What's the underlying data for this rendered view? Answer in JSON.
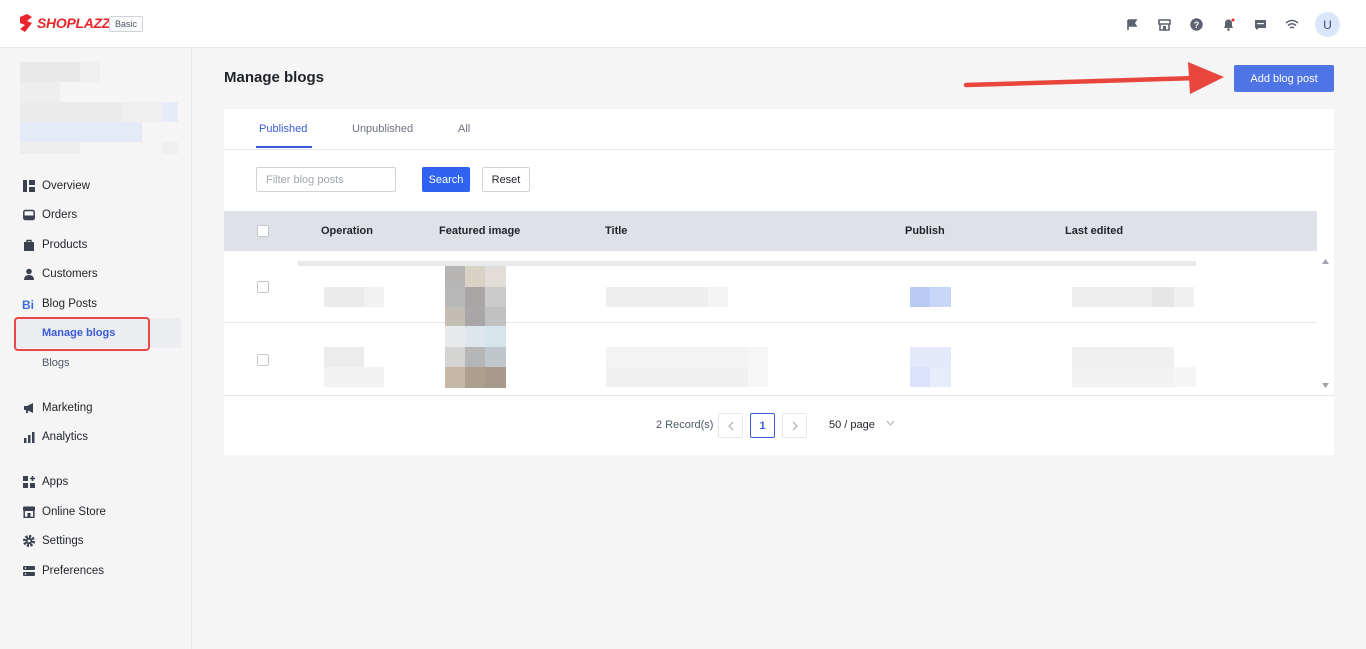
{
  "brand": {
    "name": "SHOPLAZZA",
    "plan": "Basic",
    "color": "#e8262b"
  },
  "topbar": {
    "icons": [
      "flag-icon",
      "store-icon",
      "help-icon",
      "bell-icon",
      "chat-icon",
      "wifi-icon"
    ],
    "avatar_initial": "U"
  },
  "sidebar": {
    "items": [
      {
        "label": "Overview",
        "icon": "overview-icon"
      },
      {
        "label": "Orders",
        "icon": "orders-icon"
      },
      {
        "label": "Products",
        "icon": "products-icon"
      },
      {
        "label": "Customers",
        "icon": "customers-icon"
      },
      {
        "label": "Blog Posts",
        "icon": "blog-icon"
      },
      {
        "label": "Marketing",
        "icon": "megaphone-icon"
      },
      {
        "label": "Analytics",
        "icon": "analytics-icon"
      },
      {
        "label": "Apps",
        "icon": "apps-icon"
      },
      {
        "label": "Online Store",
        "icon": "store-icon"
      },
      {
        "label": "Settings",
        "icon": "gear-icon"
      },
      {
        "label": "Preferences",
        "icon": "preferences-icon"
      }
    ],
    "blog_sub": [
      {
        "label": "Manage blogs",
        "active": true
      },
      {
        "label": "Blogs",
        "active": false
      }
    ]
  },
  "main": {
    "title": "Manage blogs",
    "add_button": "Add blog post",
    "tabs": [
      {
        "label": "Published",
        "active": true
      },
      {
        "label": "Unpublished",
        "active": false
      },
      {
        "label": "All",
        "active": false
      }
    ],
    "filter": {
      "placeholder": "Filter blog posts",
      "search_label": "Search",
      "reset_label": "Reset"
    },
    "table": {
      "columns": [
        "Operation",
        "Featured image",
        "Title",
        "Publish",
        "Last edited"
      ]
    },
    "pagination": {
      "records": "2 Record(s)",
      "current_page": "1",
      "per_page": "50 / page"
    }
  },
  "colors": {
    "accent": "#3b5bdb",
    "primary_button": "#2f63ef",
    "highlight": "#e84848"
  }
}
